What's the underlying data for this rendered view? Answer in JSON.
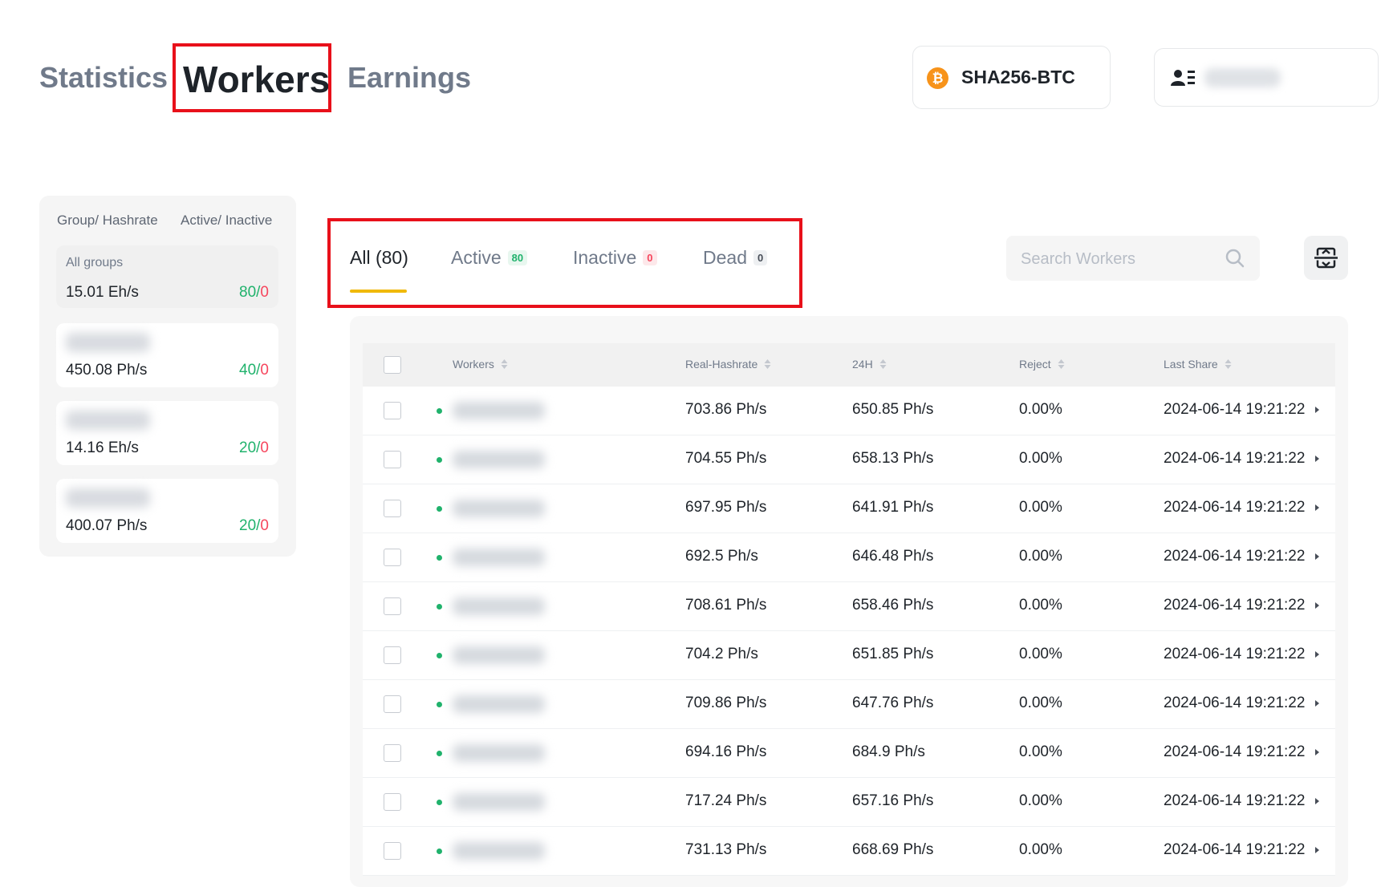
{
  "nav": {
    "tabs": [
      {
        "label": "Statistics"
      },
      {
        "label": "Workers"
      },
      {
        "label": "Earnings"
      }
    ]
  },
  "algo": {
    "coin_symbol": "₿",
    "label": "SHA256-BTC"
  },
  "groups_panel": {
    "header_group": "Group/ Hashrate",
    "header_status": "Active/ Inactive",
    "items": [
      {
        "name": "All groups",
        "hashrate": "15.01 Eh/s",
        "active": "80",
        "inactive": "0"
      },
      {
        "hashrate": "450.08 Ph/s",
        "active": "40",
        "inactive": "0"
      },
      {
        "hashrate": "14.16 Eh/s",
        "active": "20",
        "inactive": "0"
      },
      {
        "hashrate": "400.07 Ph/s",
        "active": "20",
        "inactive": "0"
      }
    ],
    "separator": "/"
  },
  "status_tabs": [
    {
      "label": "All (80)"
    },
    {
      "label": "Active",
      "badge": "80"
    },
    {
      "label": "Inactive",
      "badge": "0"
    },
    {
      "label": "Dead",
      "badge": "0"
    }
  ],
  "search": {
    "placeholder": "Search Workers"
  },
  "table": {
    "columns": [
      "Workers",
      "Real-Hashrate",
      "24H",
      "Reject",
      "Last Share"
    ],
    "rows": [
      {
        "real": "703.86 Ph/s",
        "h24": "650.85 Ph/s",
        "reject": "0.00%",
        "last": "2024-06-14 19:21:22"
      },
      {
        "real": "704.55 Ph/s",
        "h24": "658.13 Ph/s",
        "reject": "0.00%",
        "last": "2024-06-14 19:21:22"
      },
      {
        "real": "697.95 Ph/s",
        "h24": "641.91 Ph/s",
        "reject": "0.00%",
        "last": "2024-06-14 19:21:22"
      },
      {
        "real": "692.5 Ph/s",
        "h24": "646.48 Ph/s",
        "reject": "0.00%",
        "last": "2024-06-14 19:21:22"
      },
      {
        "real": "708.61 Ph/s",
        "h24": "658.46 Ph/s",
        "reject": "0.00%",
        "last": "2024-06-14 19:21:22"
      },
      {
        "real": "704.2 Ph/s",
        "h24": "651.85 Ph/s",
        "reject": "0.00%",
        "last": "2024-06-14 19:21:22"
      },
      {
        "real": "709.86 Ph/s",
        "h24": "647.76 Ph/s",
        "reject": "0.00%",
        "last": "2024-06-14 19:21:22"
      },
      {
        "real": "694.16 Ph/s",
        "h24": "684.9 Ph/s",
        "reject": "0.00%",
        "last": "2024-06-14 19:21:22"
      },
      {
        "real": "717.24 Ph/s",
        "h24": "657.16 Ph/s",
        "reject": "0.00%",
        "last": "2024-06-14 19:21:22"
      },
      {
        "real": "731.13 Ph/s",
        "h24": "668.69 Ph/s",
        "reject": "0.00%",
        "last": "2024-06-14 19:21:22"
      }
    ]
  },
  "colors": {
    "accent": "#f0b90b",
    "active": "#20b26c",
    "inactive": "#f6465d",
    "highlight_box": "#e8101a"
  }
}
